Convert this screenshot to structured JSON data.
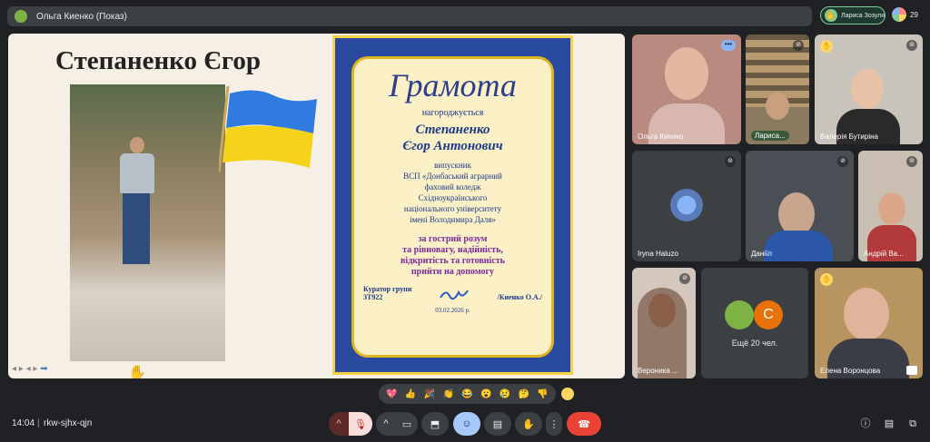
{
  "topbar": {
    "presenter_label": "Ольга Киенко (Показ)"
  },
  "speaker_pill": {
    "label": "Лариса Зозуля"
  },
  "participants_count": "29",
  "slide": {
    "name": "Степаненко Єгор",
    "certificate": {
      "title": "Грамота",
      "awarded": "нагороджується",
      "fullname_line1": "Степаненко",
      "fullname_line2": "Єгор Антонович",
      "graduate_lines": [
        "випускник",
        "ВСП «Донбаський аграрний",
        "фаховий коледж",
        "Східноукраїнського",
        "національного університету",
        "імені Володимира Даля»"
      ],
      "reason_lines": [
        "за гострий розум",
        "та рівновагу, надійність,",
        "відкритість та готовність",
        "прийти на допомогу"
      ],
      "curator_label": "Куратор групи",
      "group": "3Т922",
      "curator_name": "/Киенко О.А./",
      "date": "03.02.2026 р."
    }
  },
  "tiles": [
    {
      "name": "Ольга Киенко"
    },
    {
      "name": "Лариса..."
    },
    {
      "name": "Валерія Бутиріна"
    },
    {
      "name": "Iryna Haluzo"
    },
    {
      "name": "Даніїл"
    },
    {
      "name": "Андрій Ва..."
    },
    {
      "name": "Вероника ..."
    },
    {
      "name": "Ещё 20 чел.",
      "avatar_letter": "С"
    },
    {
      "name": "Елена Воронцова"
    }
  ],
  "bottom": {
    "time": "14:04",
    "meeting_code": "rkw-sjhx-qjn"
  },
  "reactions": [
    "💖",
    "👍",
    "🎉",
    "👏",
    "😂",
    "😮",
    "😢",
    "🤔",
    "👎"
  ],
  "colors": {
    "background": "#202124",
    "hangup": "#ea4335",
    "accent_blue": "#a8c7fa"
  }
}
